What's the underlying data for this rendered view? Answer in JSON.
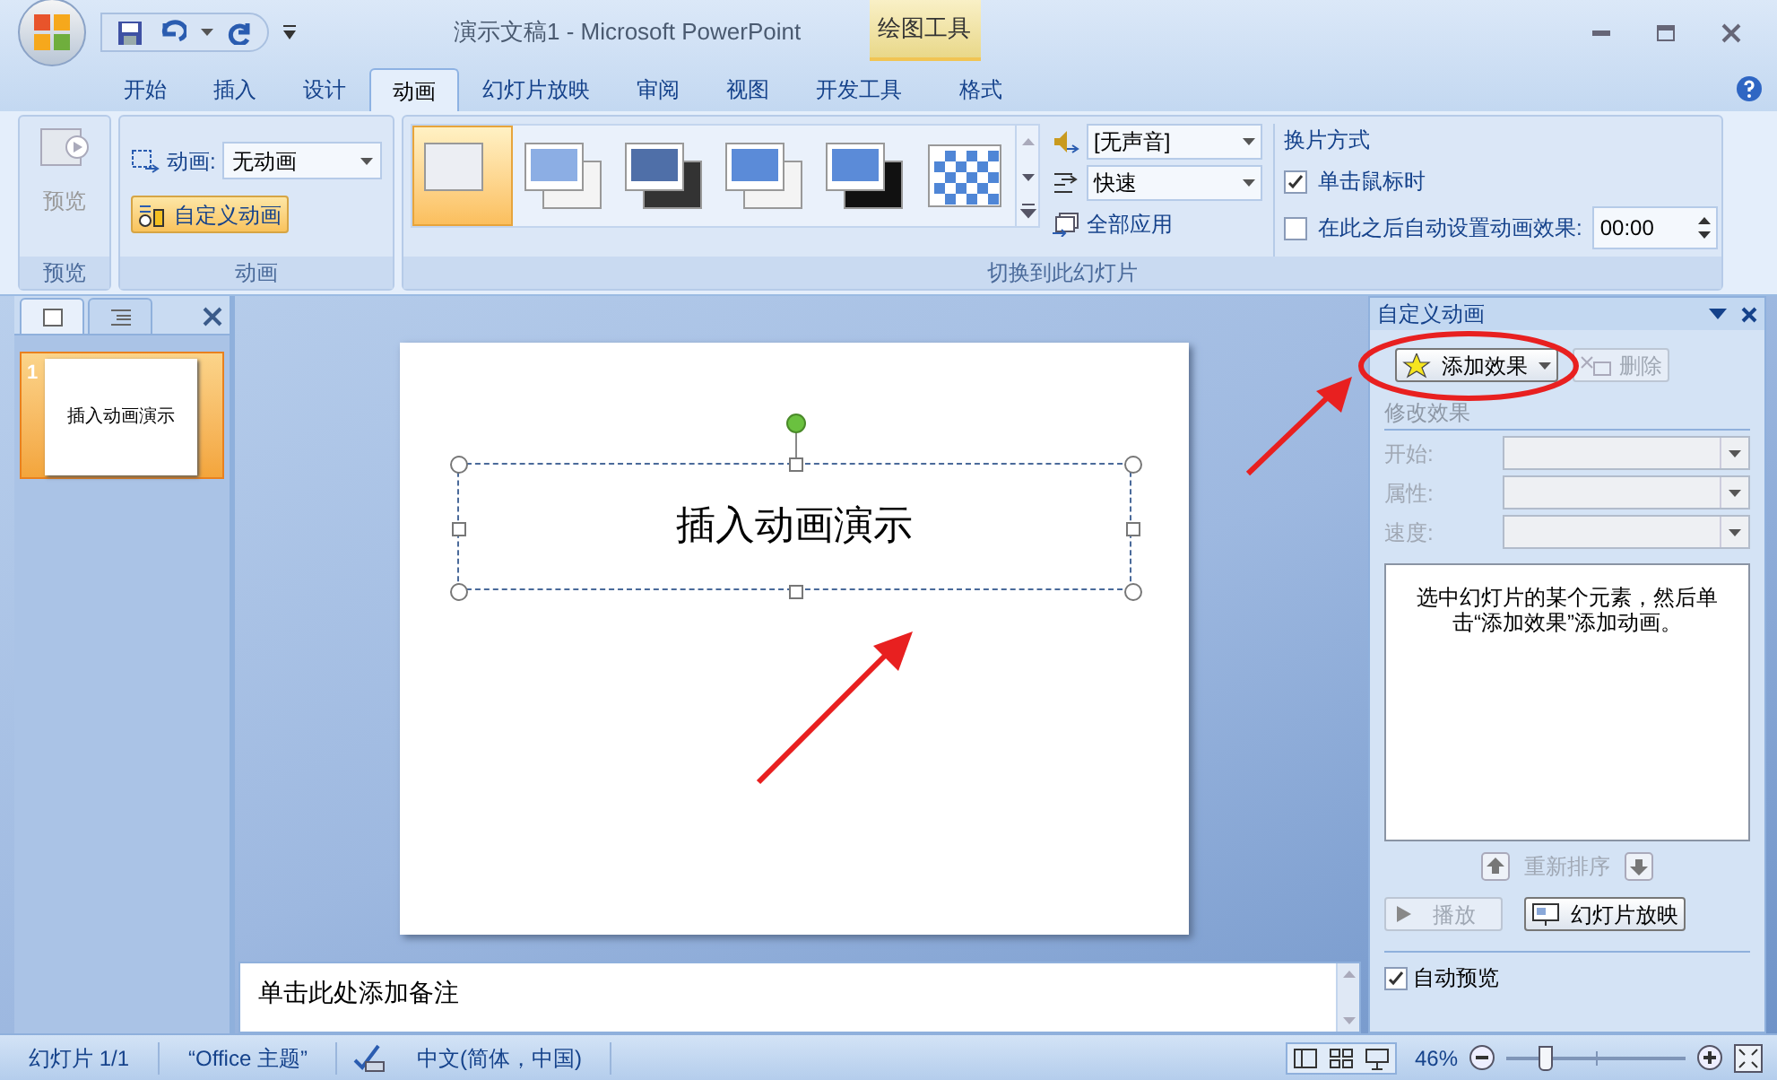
{
  "window": {
    "title": "演示文稿1 - Microsoft PowerPoint",
    "context_group": "绘图工具"
  },
  "tabs": [
    {
      "label": "开始",
      "selected": false
    },
    {
      "label": "插入",
      "selected": false
    },
    {
      "label": "设计",
      "selected": false
    },
    {
      "label": "动画",
      "selected": true
    },
    {
      "label": "幻灯片放映",
      "selected": false
    },
    {
      "label": "审阅",
      "selected": false
    },
    {
      "label": "视图",
      "selected": false
    },
    {
      "label": "开发工具",
      "selected": false
    },
    {
      "label": "格式",
      "selected": false
    }
  ],
  "ribbon": {
    "preview": {
      "button": "预览",
      "group_label": "预览"
    },
    "animation": {
      "label": "动画:",
      "value": "无动画",
      "custom_button": "自定义动画",
      "group_label": "动画"
    },
    "transition": {
      "group_label": "切换到此幻灯片",
      "gallery": [
        {
          "selected": true
        },
        {
          "selected": false
        },
        {
          "selected": false
        },
        {
          "selected": false
        },
        {
          "selected": false
        },
        {
          "selected": false
        }
      ],
      "sound": "[无声音]",
      "speed": "快速",
      "apply_all": "全部应用",
      "advance_title": "换片方式",
      "on_click": {
        "label": "单击鼠标时",
        "checked": true
      },
      "after": {
        "label": "在此之后自动设置动画效果:",
        "checked": false,
        "value": "00:00"
      }
    }
  },
  "slides_pane": {
    "thumbnails": [
      {
        "number": "1",
        "text": "插入动画演示",
        "selected": true
      }
    ]
  },
  "slide": {
    "title": "插入动画演示"
  },
  "notes": {
    "placeholder": "单击此处添加备注"
  },
  "task_pane": {
    "title": "自定义动画",
    "add_effect": "添加效果",
    "remove": {
      "label": "删除",
      "disabled": true
    },
    "section": "修改效果",
    "fields": [
      {
        "label": "开始:",
        "disabled": true
      },
      {
        "label": "属性:",
        "disabled": true
      },
      {
        "label": "速度:",
        "disabled": true
      }
    ],
    "hint": "选中幻灯片的某个元素，然后单击“添加效果”添加动画。",
    "reorder": "重新排序",
    "play": {
      "label": "播放",
      "disabled": true
    },
    "slideshow": "幻灯片放映",
    "autopreview": {
      "label": "自动预览",
      "checked": true
    }
  },
  "status_bar": {
    "items": [
      "幻灯片 1/1",
      "“Office 主题”",
      "中文(简体，中国)"
    ],
    "zoom": "46%",
    "zoom_level": {
      "level": 0.22
    }
  }
}
